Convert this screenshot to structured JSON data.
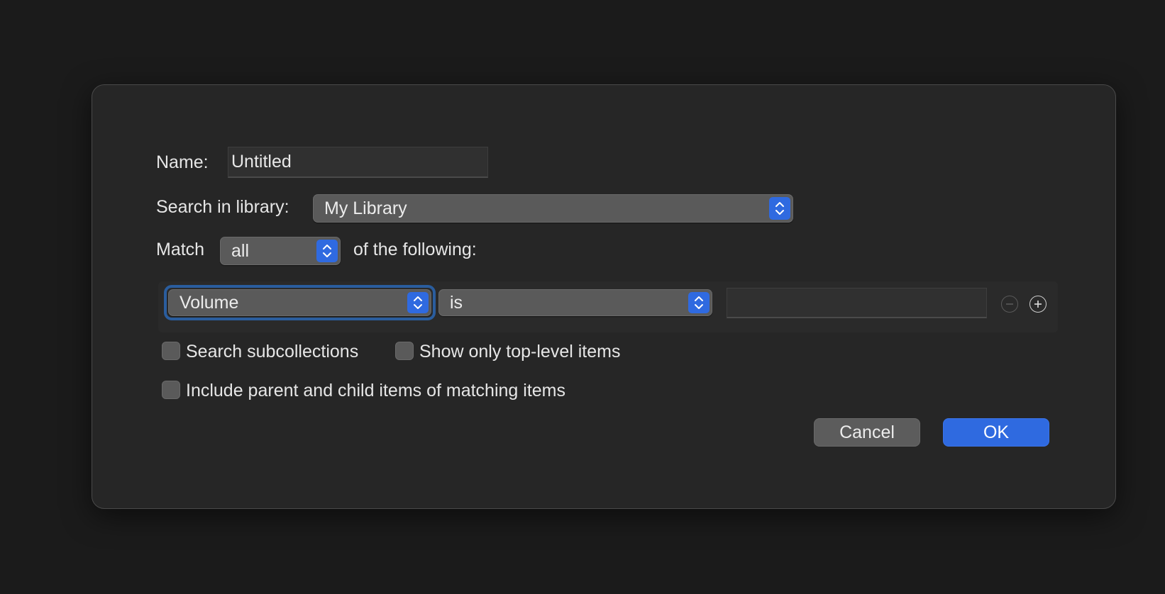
{
  "dialog": {
    "name_label": "Name:",
    "name_value": "Untitled",
    "library_label": "Search in library:",
    "library_value": "My Library",
    "match_label": "Match",
    "match_value": "all",
    "match_suffix": "of the following:",
    "condition": {
      "field": "Volume",
      "operator": "is",
      "value": ""
    },
    "checkboxes": {
      "search_subcollections": {
        "label": "Search subcollections",
        "checked": false
      },
      "show_top_level": {
        "label": "Show only top-level items",
        "checked": false
      },
      "include_parent_child": {
        "label": "Include parent and child items of matching items",
        "checked": false
      }
    },
    "buttons": {
      "cancel": "Cancel",
      "ok": "OK"
    },
    "icons": {
      "remove": "minus-circle-icon",
      "add": "plus-circle-icon",
      "stepper": "up-down-chevron-icon"
    },
    "colors": {
      "accent": "#2f6ae0",
      "background": "#262626",
      "control": "#5a5a5a"
    }
  }
}
